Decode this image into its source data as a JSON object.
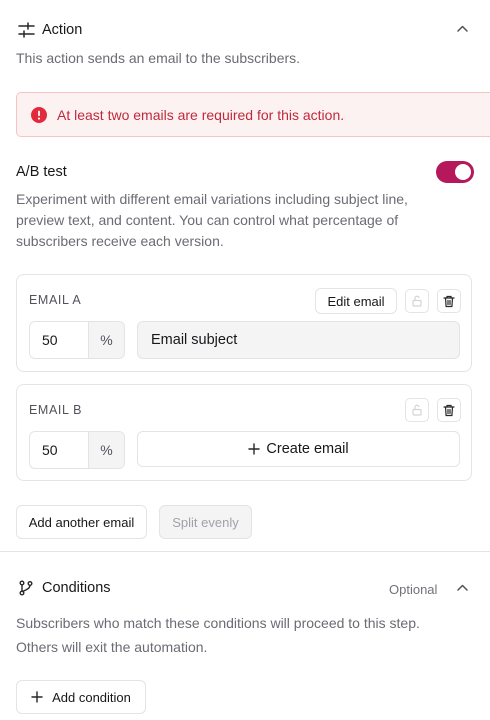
{
  "action": {
    "title": "Action",
    "description": "This action sends an email to the subscribers.",
    "icon": "sliders-icon"
  },
  "error_banner": {
    "message": "At least two emails are required for this action.",
    "color": "#c0293b",
    "background": "#fdf2f2"
  },
  "ab_test": {
    "label": "A/B test",
    "enabled": true,
    "toggle_color": "#b5195b",
    "description_lines": [
      "Experiment with different email variations including subject line,",
      "preview text, and content. You can control what percentage of",
      "subscribers receive each version."
    ]
  },
  "emails": [
    {
      "label": "EMAIL A",
      "percent": "50",
      "unit": "%",
      "edit_label": "Edit email",
      "subject": "Email subject"
    },
    {
      "label": "EMAIL B",
      "percent": "50",
      "unit": "%",
      "create_label": "Create email"
    }
  ],
  "buttons": {
    "add_another": "Add another email",
    "split_evenly": "Split evenly"
  },
  "conditions": {
    "title": "Conditions",
    "optional": "Optional",
    "description_lines": [
      "Subscribers who match these conditions will proceed to this step.",
      "Others will exit the automation."
    ],
    "add_label": "Add condition",
    "icon": "git-branch-icon"
  }
}
